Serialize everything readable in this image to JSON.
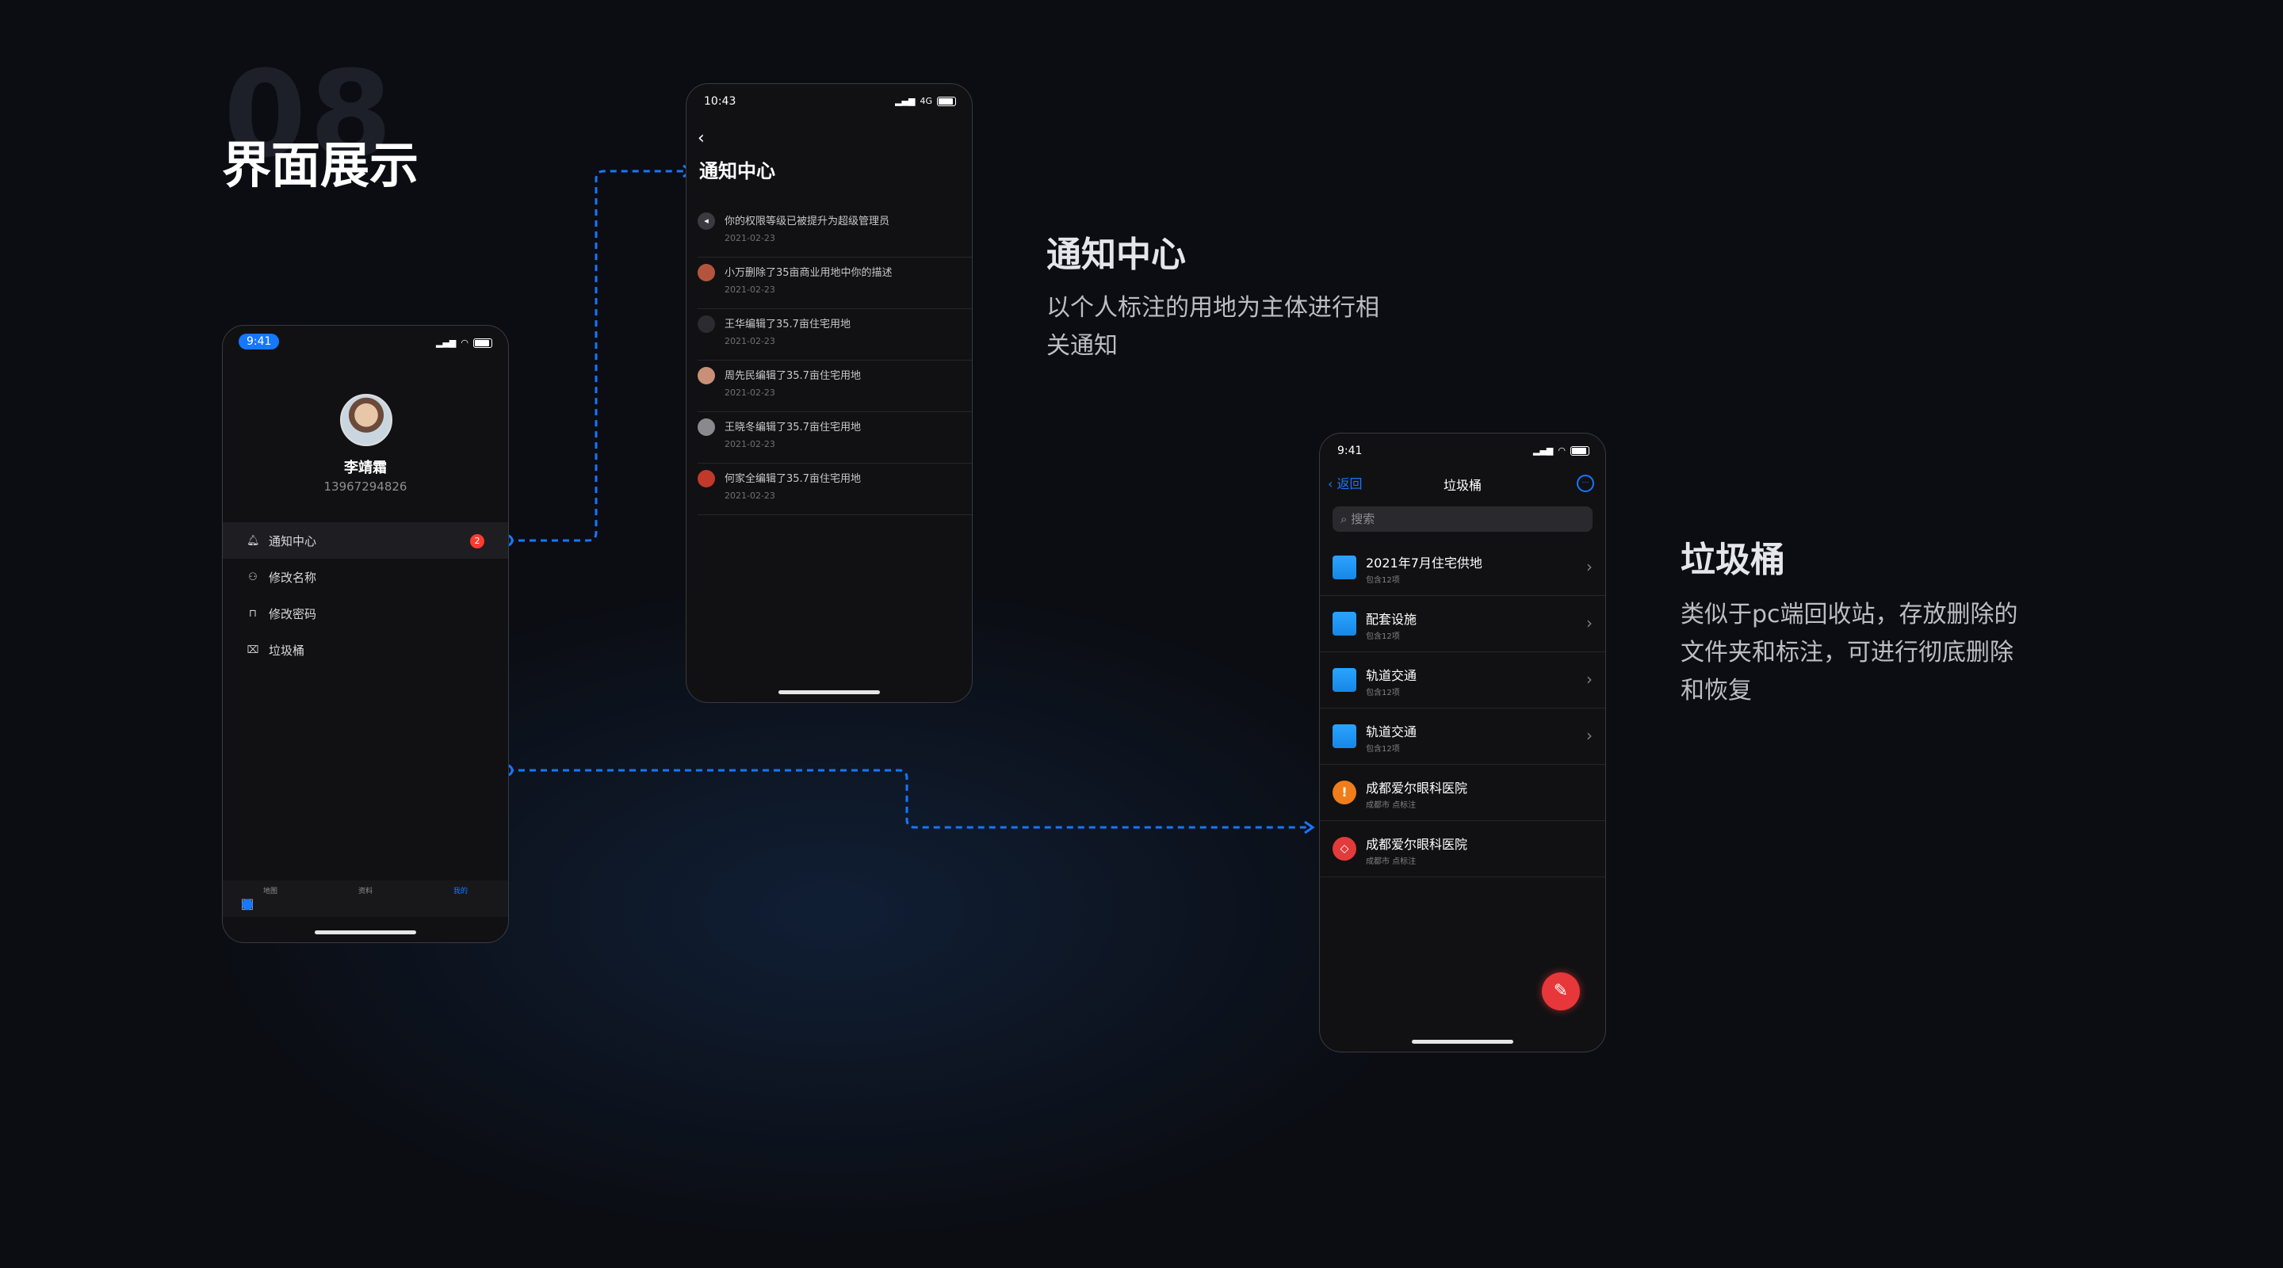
{
  "section": {
    "number": "08",
    "title": "界面展示"
  },
  "colors": {
    "accent": "#1677ff",
    "badge": "#ff3b30",
    "background": "#0b0d13"
  },
  "profile_screen": {
    "status_time": "9:41",
    "name": "李靖霜",
    "phone": "13967294826",
    "menu": [
      {
        "icon": "bell-icon",
        "label": "通知中心",
        "badge": "2"
      },
      {
        "icon": "user-icon",
        "label": "修改名称"
      },
      {
        "icon": "lock-icon",
        "label": "修改密码"
      },
      {
        "icon": "trash-icon",
        "label": "垃圾桶"
      }
    ],
    "tabs": [
      {
        "icon": "map-icon",
        "label": "地图"
      },
      {
        "icon": "folder-icon",
        "label": "资料"
      },
      {
        "icon": "person-icon",
        "label": "我的",
        "active": true
      }
    ]
  },
  "notification_screen": {
    "status_time": "10:43",
    "signal": "4G",
    "title": "通知中心",
    "items": [
      {
        "text": "你的权限等级已被提升为超级管理员",
        "date": "2021-02-23"
      },
      {
        "text": "小万删除了35亩商业用地中你的描述",
        "date": "2021-02-23"
      },
      {
        "text": "王华编辑了35.7亩住宅用地",
        "date": "2021-02-23"
      },
      {
        "text": "周先民编辑了35.7亩住宅用地",
        "date": "2021-02-23"
      },
      {
        "text": "王晓冬编辑了35.7亩住宅用地",
        "date": "2021-02-23"
      },
      {
        "text": "何家全编辑了35.7亩住宅用地",
        "date": "2021-02-23"
      }
    ]
  },
  "trash_screen": {
    "status_time": "9:41",
    "back_label": "返回",
    "title": "垃圾桶",
    "search_placeholder": "搜索",
    "items": [
      {
        "type": "folder",
        "name": "2021年7月住宅供地",
        "sub": "包含12项"
      },
      {
        "type": "folder",
        "name": "配套设施",
        "sub": "包含12项"
      },
      {
        "type": "folder",
        "name": "轨道交通",
        "sub": "包含12项"
      },
      {
        "type": "folder",
        "name": "轨道交通",
        "sub": "包含12项"
      },
      {
        "type": "mark-point",
        "name": "成都爱尔眼科医院",
        "sub": "成都市 点标注"
      },
      {
        "type": "mark-area",
        "name": "成都爱尔眼科医院",
        "sub": "成都市 点标注"
      }
    ]
  },
  "notification_desc": {
    "title": "通知中心",
    "lines": [
      "以个人标注的用地为主体进行相",
      "关通知"
    ]
  },
  "trash_desc": {
    "title": "垃圾桶",
    "lines": [
      "类似于pc端回收站，存放删除的",
      "文件夹和标注，可进行彻底删除",
      "和恢复"
    ]
  }
}
